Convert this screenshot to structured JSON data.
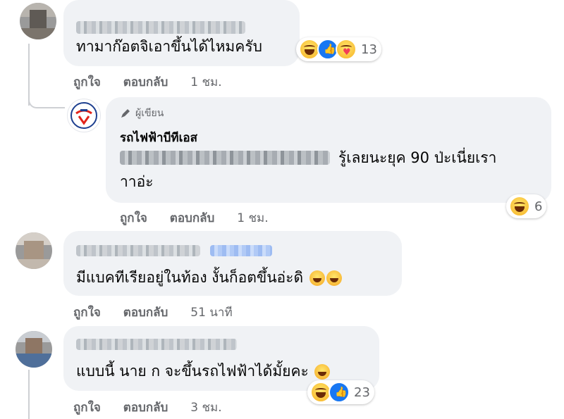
{
  "comments": [
    {
      "text": "ทามาก๊อตจิเอาขึ้นได้ไหมครับ",
      "reaction_count": "13",
      "reactions": [
        "haha-icon",
        "like-icon",
        "care-icon"
      ],
      "actions": {
        "like": "ถูกใจ",
        "reply": "ตอบกลับ",
        "time": "1 ชม."
      }
    },
    {
      "is_reply": true,
      "author_badge": "ผู้เขียน",
      "author_name": "รถไฟฟ้าบีทีเอส",
      "text_line1": "รู้เลยนะยุค 90 ป่ะเนี่ยเรา",
      "text_line2": "าาอ่ะ",
      "reaction_count": "6",
      "reactions": [
        "haha-icon"
      ],
      "actions": {
        "like": "ถูกใจ",
        "reply": "ตอบกลับ",
        "time": "1 ชม."
      }
    },
    {
      "text": "มีแบคทีเรียอยู่ในท้อง งั้นก็อตขึ้นอ่ะดิ",
      "emojis": [
        "rofl-icon",
        "rofl-icon"
      ],
      "actions": {
        "like": "ถูกใจ",
        "reply": "ตอบกลับ",
        "time": "51 นาที"
      }
    },
    {
      "text": "แบบนี้ นาย ก จะขึ้นรถไฟฟ้าได้มั้ยคะ",
      "emojis": [
        "yawn-icon"
      ],
      "reaction_count": "23",
      "reactions": [
        "haha-icon",
        "like-icon"
      ],
      "actions": {
        "like": "ถูกใจ",
        "reply": "ตอบกลับ",
        "time": "3 ชม."
      }
    }
  ],
  "colors": {
    "bubble": "#f0f2f5",
    "secondary_text": "#65676b",
    "like_blue": "#1877f2",
    "bts_red": "#e2231a",
    "bts_blue": "#1d3f8f"
  }
}
